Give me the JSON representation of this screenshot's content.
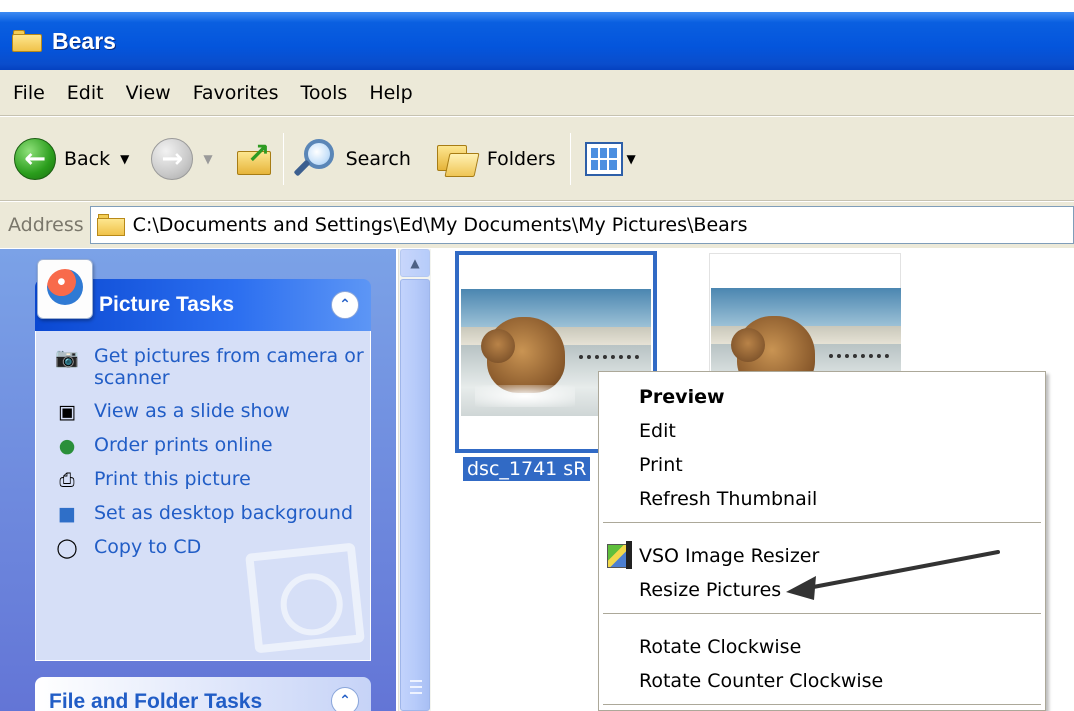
{
  "window": {
    "title": "Bears"
  },
  "menubar": {
    "items": [
      "File",
      "Edit",
      "View",
      "Favorites",
      "Tools",
      "Help"
    ]
  },
  "toolbar": {
    "back_label": "Back",
    "search_label": "Search",
    "folders_label": "Folders"
  },
  "address": {
    "label": "Address",
    "path": "C:\\Documents and Settings\\Ed\\My Documents\\My Pictures\\Bears"
  },
  "picture_tasks": {
    "title": "Picture Tasks",
    "items": [
      {
        "label": "Get pictures from camera or scanner",
        "icon": "camera-icon"
      },
      {
        "label": "View as a slide show",
        "icon": "slideshow-icon"
      },
      {
        "label": "Order prints online",
        "icon": "globe-icon"
      },
      {
        "label": "Print this picture",
        "icon": "printer-icon"
      },
      {
        "label": "Set as desktop background",
        "icon": "desktop-icon"
      },
      {
        "label": "Copy to CD",
        "icon": "cd-icon"
      }
    ]
  },
  "file_folder_tasks": {
    "title": "File and Folder Tasks"
  },
  "files": [
    {
      "name": "dsc_1741 sR",
      "selected": true
    },
    {
      "name": "",
      "selected": false
    }
  ],
  "context_menu": {
    "group1": [
      "Preview",
      "Edit",
      "Print",
      "Refresh Thumbnail"
    ],
    "group2": [
      "VSO Image Resizer",
      "Resize Pictures"
    ],
    "group3": [
      "Rotate Clockwise",
      "Rotate Counter Clockwise"
    ]
  },
  "colors": {
    "title_bar": "#0455dc",
    "selection": "#316ac5",
    "task_link": "#215dc6",
    "task_pane": "#6375d6"
  }
}
